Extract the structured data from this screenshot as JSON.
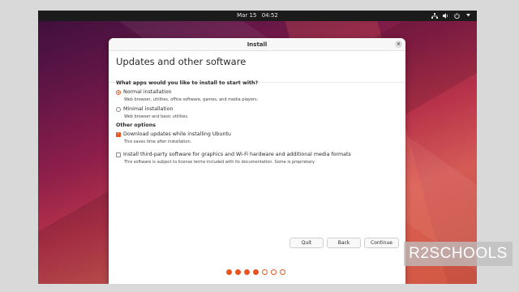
{
  "topbar": {
    "date": "Mar 15",
    "time": "04:52",
    "icons": [
      "network-icon",
      "volume-icon",
      "power-icon",
      "menu-caret-icon"
    ]
  },
  "window": {
    "title": "Install",
    "heading": "Updates and other software"
  },
  "apps_question": "What apps would you like to install to start with?",
  "options": {
    "normal": {
      "label": "Normal installation",
      "description": "Web browser, utilities, office software, games, and media players.",
      "selected": true
    },
    "minimal": {
      "label": "Minimal installation",
      "description": "Web browser and basic utilities.",
      "selected": false
    }
  },
  "other_options": {
    "title": "Other options",
    "download_updates": {
      "label": "Download updates while installing Ubuntu",
      "description": "This saves time after installation.",
      "checked": true
    },
    "third_party": {
      "label": "Install third-party software for graphics and Wi-Fi hardware and additional media formats",
      "description": "This software is subject to license terms included with its documentation. Some is proprietary.",
      "checked": false
    }
  },
  "buttons": {
    "quit": "Quit",
    "back": "Back",
    "continue": "Continue"
  },
  "progress": {
    "total_steps": 7,
    "completed_steps": 4
  },
  "colors": {
    "accent": "#e95420",
    "topbar": "#1b1b1b"
  },
  "watermark": "R2SCHOOLS"
}
